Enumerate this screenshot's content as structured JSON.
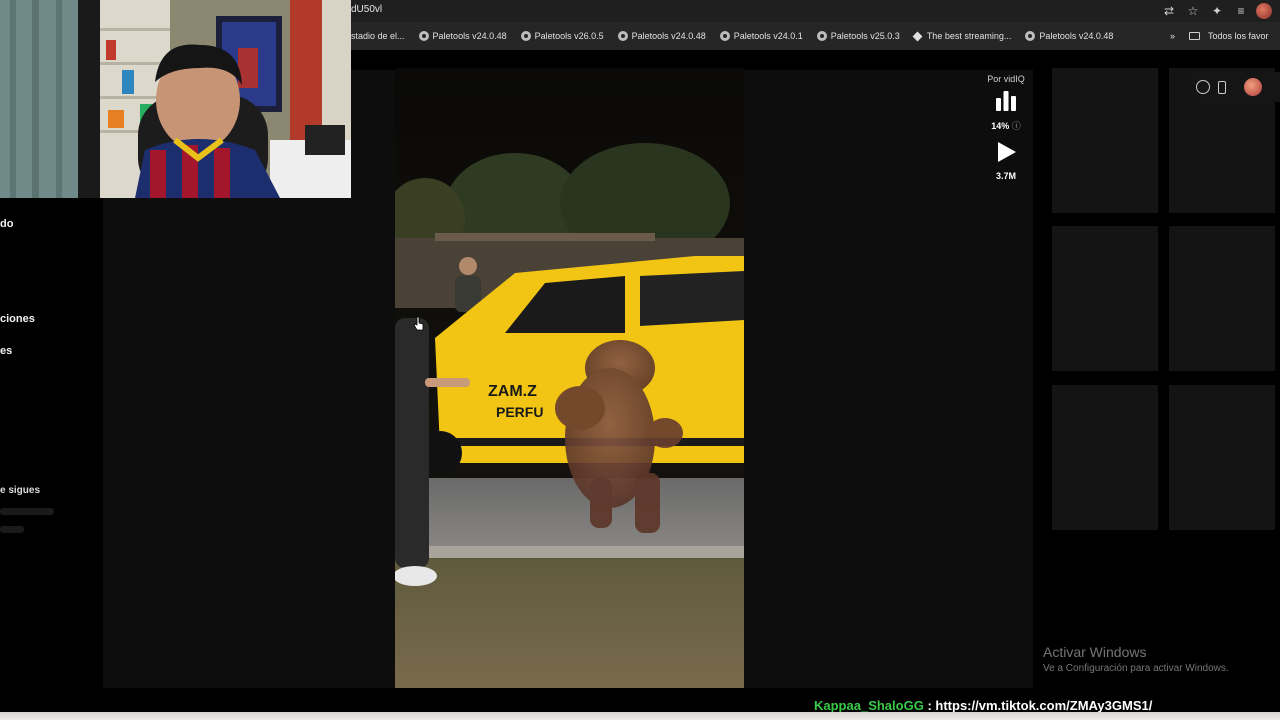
{
  "browser": {
    "url_fragment": "dU50vl",
    "bookmarks": [
      {
        "label": "stadio de el...",
        "icon": "none"
      },
      {
        "label": "Paletools v24.0.48",
        "icon": "globe-icon"
      },
      {
        "label": "Paletools v26.0.5",
        "icon": "globe-icon"
      },
      {
        "label": "Paletools v24.0.48",
        "icon": "globe-icon"
      },
      {
        "label": "Paletools v24.0.1",
        "icon": "globe-icon"
      },
      {
        "label": "Paletools v25.0.3",
        "icon": "globe-icon"
      },
      {
        "label": "The best streaming...",
        "icon": "diamond-icon"
      },
      {
        "label": "Paletools v24.0.48",
        "icon": "globe-icon"
      }
    ],
    "bookmarks_overflow": "»",
    "all_bookmarks": "Todos los favor"
  },
  "sidebar": {
    "items": [
      "do",
      "ciones",
      "es"
    ],
    "following_header": "e sigues"
  },
  "vidiq": {
    "label": "Por vidIQ",
    "score_pct": "14%",
    "views": "3.7M"
  },
  "video": {
    "car_text_line1": "ZAM.Z",
    "car_text_line2": "PERFU"
  },
  "windows_watermark": {
    "title": "Activar Windows",
    "subtitle": "Ve a Configuración para activar Windows."
  },
  "chat": {
    "user": "Kappaa_ShaloGG",
    "separator": ":",
    "message": "https://vm.tiktok.com/ZMAy3GMS1/"
  },
  "colors": {
    "chat_user": "#38c948",
    "car_yellow": "#f2c514"
  }
}
